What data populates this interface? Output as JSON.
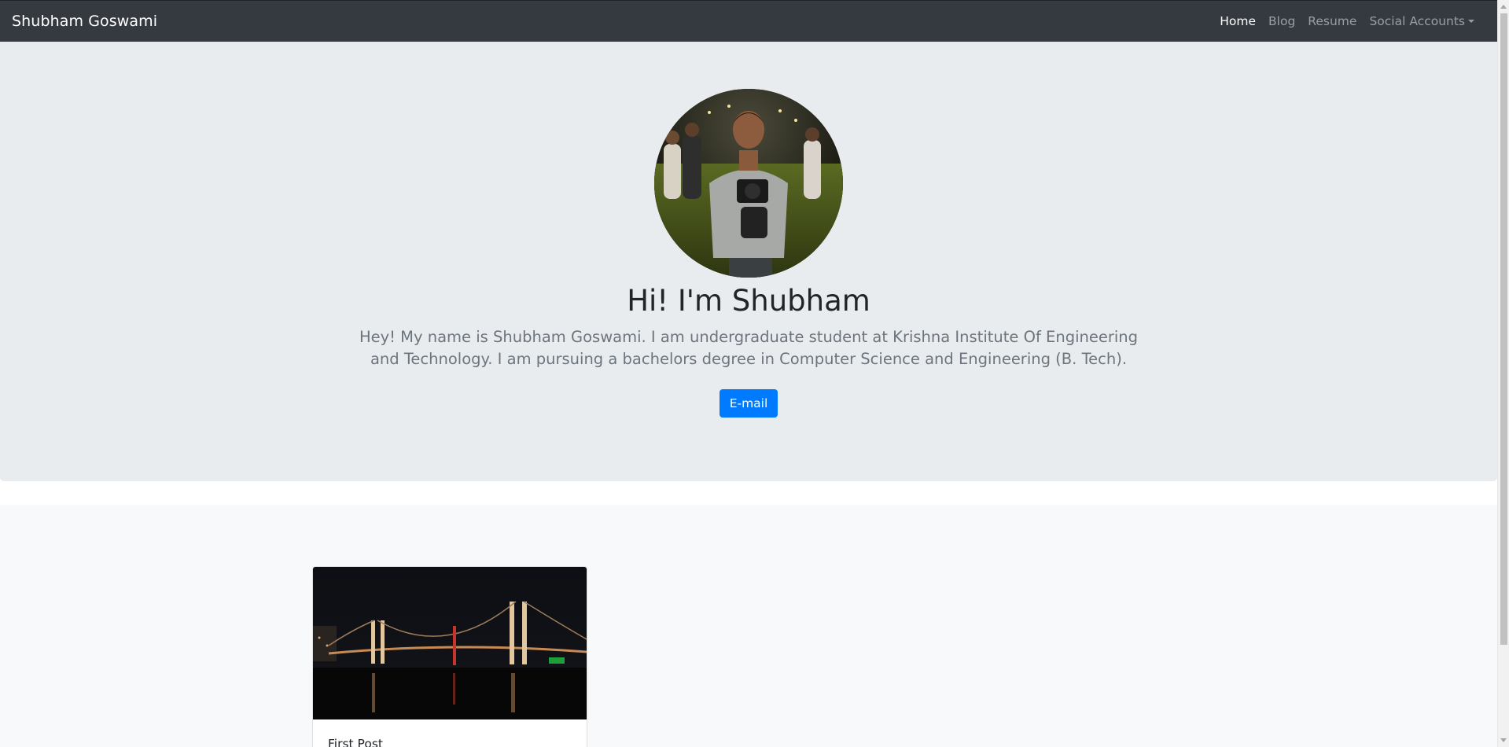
{
  "navbar": {
    "brand": "Shubham Goswami",
    "links": [
      {
        "label": "Home",
        "active": true
      },
      {
        "label": "Blog",
        "active": false
      },
      {
        "label": "Resume",
        "active": false
      },
      {
        "label": "Social Accounts",
        "active": false,
        "dropdown": true
      }
    ]
  },
  "hero": {
    "title": "Hi! I'm Shubham",
    "lead": "Hey! My name is Shubham Goswami. I am undergraduate student at Krishna Institute Of Engineering and Technology. I am pursuing a bachelors degree in Computer Science and Engineering (B. Tech).",
    "button_label": "E-mail",
    "avatar_icon": "profile-photo"
  },
  "posts": [
    {
      "title": "First Post",
      "image": "bridge-night-photo"
    }
  ],
  "colors": {
    "navbar_bg": "#343a40",
    "hero_bg": "#e9ecef",
    "posts_bg": "#f8f9fa",
    "primary": "#007bff"
  }
}
